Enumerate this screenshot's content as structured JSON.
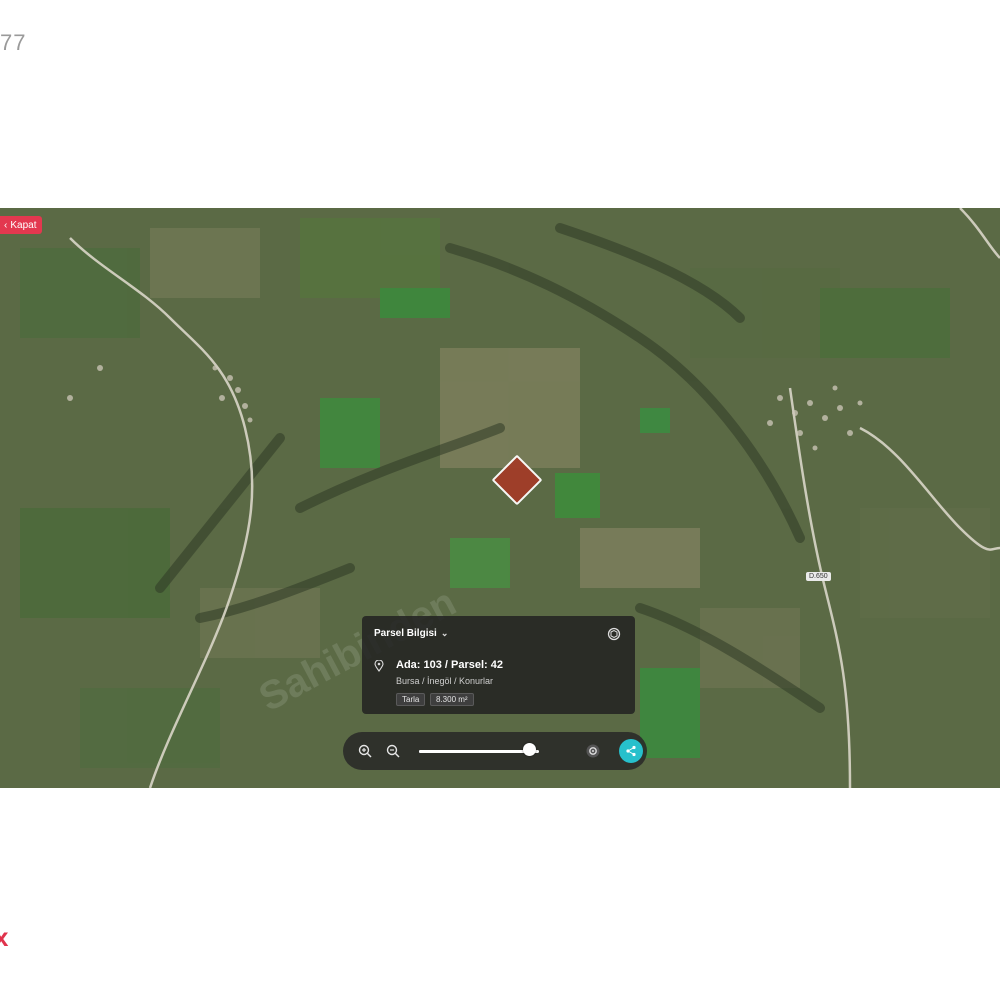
{
  "page": {
    "corner_text": "77",
    "corner_mark": "x"
  },
  "map": {
    "back_button": {
      "icon": "chevron-left-icon",
      "label": "Kapat"
    },
    "road_label": "D.650",
    "watermark": "Sahibinden"
  },
  "info_card": {
    "title": "Parsel Bilgisi",
    "title_icon": "chevron-down-icon",
    "action_icon": "3d-cube-icon",
    "location_icon": "map-pin-icon",
    "parcel": "Ada: 103 / Parsel: 42",
    "location": "Bursa / İnegöl / Konurlar",
    "type_tag": "Tarla",
    "area_tag": "8.300 m²"
  },
  "toolbar": {
    "zoom_in_icon": "zoom-in-icon",
    "zoom_out_icon": "zoom-out-icon",
    "slider_value": 0.92,
    "settings_icon": "gear-icon",
    "share_icon": "share-icon",
    "accent_color": "#27c0cc"
  }
}
